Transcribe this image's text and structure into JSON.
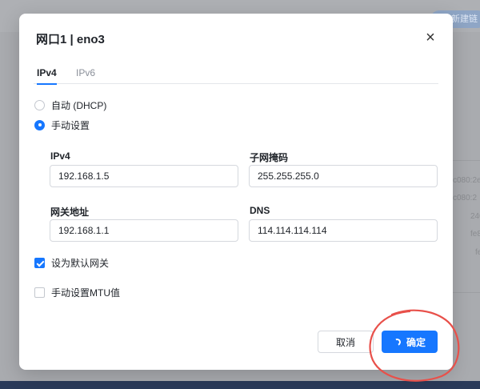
{
  "background": {
    "topbar_button": "新建链",
    "side_texts": [
      "c080:2e",
      "c080:2",
      "240",
      "fe8",
      "fe"
    ]
  },
  "dialog": {
    "title": "网口1 | eno3",
    "close_symbol": "×",
    "tabs": [
      {
        "label": "IPv4",
        "active": true
      },
      {
        "label": "IPv6",
        "active": false
      }
    ],
    "mode_options": [
      {
        "label": "自动 (DHCP)",
        "checked": false
      },
      {
        "label": "手动设置",
        "checked": true
      }
    ],
    "fields": {
      "ipv4": {
        "label": "IPv4",
        "value": "192.168.1.5"
      },
      "subnet_mask": {
        "label": "子网掩码",
        "value": "255.255.255.0"
      },
      "gateway": {
        "label": "网关地址",
        "value": "192.168.1.1"
      },
      "dns": {
        "label": "DNS",
        "value": "114.114.114.114"
      }
    },
    "options": {
      "default_gateway": {
        "label": "设为默认网关",
        "checked": true
      },
      "manual_mtu": {
        "label": "手动设置MTU值",
        "checked": false
      }
    },
    "buttons": {
      "cancel": "取消",
      "confirm": "确定"
    }
  },
  "colors": {
    "accent": "#1677ff",
    "annotation": "#e8504a"
  }
}
